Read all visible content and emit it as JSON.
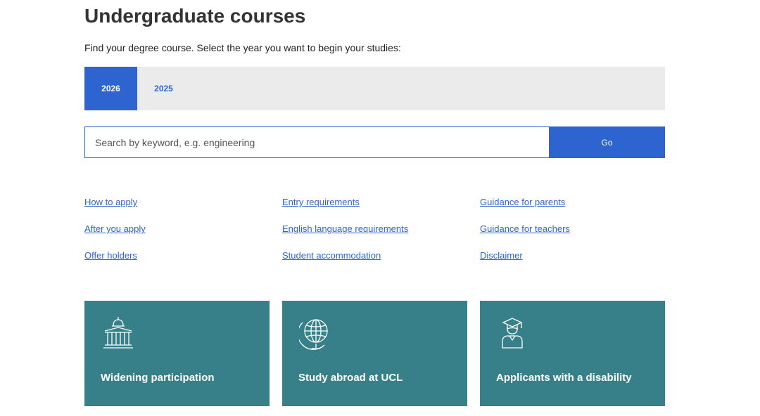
{
  "page": {
    "title": "Undergraduate courses",
    "intro": "Find your degree course. Select the year you want to begin your studies:"
  },
  "year_tabs": [
    {
      "label": "2026",
      "active": true
    },
    {
      "label": "2025",
      "active": false
    }
  ],
  "search": {
    "placeholder": "Search by keyword, e.g. engineering",
    "value": "",
    "button_label": "Go"
  },
  "links": {
    "col1": [
      "How to apply",
      "After you apply",
      "Offer holders"
    ],
    "col2": [
      "Entry requirements",
      "English language requirements",
      "Student accommodation"
    ],
    "col3": [
      "Guidance for parents",
      "Guidance for teachers",
      "Disclaimer"
    ]
  },
  "cards": [
    {
      "title": "Widening participation",
      "icon": "university-building-icon"
    },
    {
      "title": "Study abroad at UCL",
      "icon": "globe-icon"
    },
    {
      "title": "Applicants with a disability",
      "icon": "graduate-icon"
    }
  ],
  "colors": {
    "accent": "#2d64d0",
    "tab_bar": "#ebebeb",
    "card": "#37808a"
  }
}
